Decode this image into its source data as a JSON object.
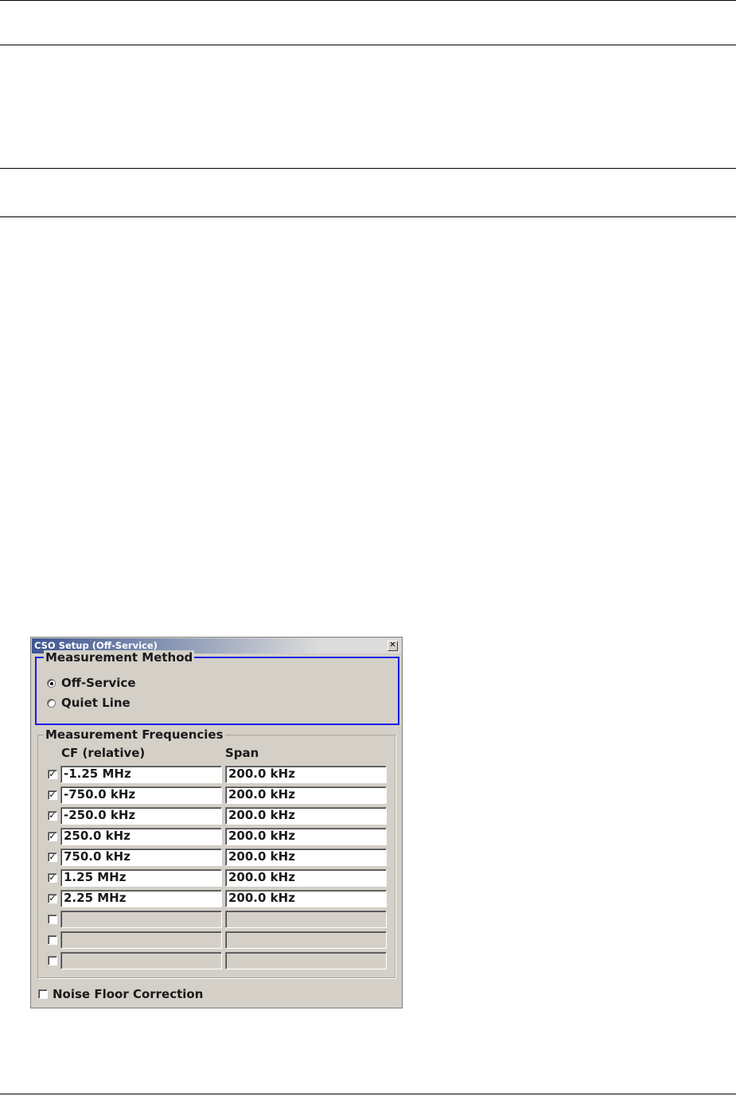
{
  "dialog": {
    "title": "CSO Setup (Off-Service)",
    "close_glyph": "✕",
    "method": {
      "legend": "Measurement Method",
      "options": [
        {
          "label": "Off-Service",
          "selected": true
        },
        {
          "label": "Quiet Line",
          "selected": false
        }
      ]
    },
    "frequencies": {
      "legend": "Measurement Frequencies",
      "col_cf": "CF (relative)",
      "col_span": "Span",
      "rows": [
        {
          "checked": true,
          "cf": "-1.25 MHz",
          "span": "200.0 kHz"
        },
        {
          "checked": true,
          "cf": "-750.0 kHz",
          "span": "200.0 kHz"
        },
        {
          "checked": true,
          "cf": "-250.0 kHz",
          "span": "200.0 kHz"
        },
        {
          "checked": true,
          "cf": "250.0 kHz",
          "span": "200.0 kHz"
        },
        {
          "checked": true,
          "cf": "750.0 kHz",
          "span": "200.0 kHz"
        },
        {
          "checked": true,
          "cf": "1.25 MHz",
          "span": "200.0 kHz"
        },
        {
          "checked": true,
          "cf": "2.25 MHz",
          "span": "200.0 kHz"
        },
        {
          "checked": false,
          "cf": "",
          "span": ""
        },
        {
          "checked": false,
          "cf": "",
          "span": ""
        },
        {
          "checked": false,
          "cf": "",
          "span": ""
        }
      ]
    },
    "noise_floor": {
      "label": "Noise Floor Correction",
      "checked": false
    },
    "check_glyph": "✓"
  }
}
